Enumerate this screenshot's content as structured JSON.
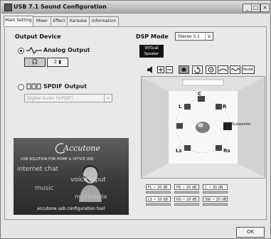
{
  "window": {
    "title": "USB 7.1 Sound Configuration"
  },
  "titlebar": {
    "minimize": "_",
    "maximize": "□",
    "close": "×"
  },
  "tabs": [
    {
      "label": "Main Setting"
    },
    {
      "label": "Mixer"
    },
    {
      "label": "Effect"
    },
    {
      "label": "Karaoke"
    },
    {
      "label": "Information"
    }
  ],
  "output": {
    "heading": "Output Device",
    "analog_label": "Analog Output",
    "headphone_button": "🎧",
    "two_ch_button": "2 ▮",
    "spdif_label": "SPDIF Output",
    "spdif_select": "Digital Audio (S/PDIF)"
  },
  "dsp": {
    "heading": "DSP Mode",
    "mode_value": "Stereo 5.1",
    "virtual_label": "Virtual",
    "virtual_sub": "Speaker",
    "reset_label": "Reset",
    "subwoofer_label": "Subwoofer"
  },
  "speakers": {
    "left": "L",
    "center": "C",
    "right": "R",
    "left_surround": "Ls",
    "right_surround": "Rs"
  },
  "levels": [
    {
      "label": "FL ~ 20 dB"
    },
    {
      "label": "FR ~ 20 dB"
    },
    {
      "label": "C ~ 20 dB"
    },
    {
      "label": "LS ~ 20 dB"
    },
    {
      "label": "RS ~ 20 dB"
    },
    {
      "label": "SW ~ 20 dB"
    }
  ],
  "banner": {
    "brand": "Accutone",
    "tagline": "USB SOLUTION FOR HOME & OFFICE USE",
    "word1": "internet chat",
    "word2": "voice input",
    "word3": "music",
    "word4": "multimedia",
    "footer": "accutone usb configuration tool"
  },
  "buttons": {
    "ok": "OK"
  }
}
